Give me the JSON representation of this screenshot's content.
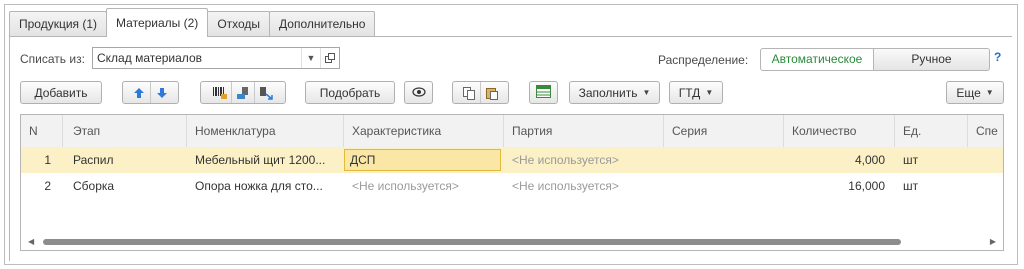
{
  "tabs": [
    {
      "label": "Продукция (1)"
    },
    {
      "label": "Материалы (2)"
    },
    {
      "label": "Отходы"
    },
    {
      "label": "Дополнительно"
    }
  ],
  "write_off": {
    "label": "Списать из:",
    "value": "Склад материалов"
  },
  "distribution": {
    "label": "Распределение:",
    "auto": "Автоматическое",
    "manual": "Ручное",
    "help": "?"
  },
  "toolbar": {
    "add": "Добавить",
    "pick": "Подобрать",
    "fill": "Заполнить",
    "gtd": "ГТД",
    "more": "Еще"
  },
  "table": {
    "columns": [
      "N",
      "Этап",
      "Номенклатура",
      "Характеристика",
      "Партия",
      "Серия",
      "Количество",
      "Ед.",
      "Спе"
    ],
    "rows": [
      [
        "1",
        "Распил",
        "Мебельный щит 1200...",
        "ДСП",
        "<Не используется>",
        "",
        "4,000",
        "шт",
        ""
      ],
      [
        "2",
        "Сборка",
        "Опора ножка для сто...",
        "<Не используется>",
        "<Не используется>",
        "",
        "16,000",
        "шт",
        ""
      ]
    ]
  },
  "colors": {
    "accent_green": "#2a8a3a",
    "selected_row": "#fbf0c6",
    "help_blue": "#2a6cc4"
  }
}
